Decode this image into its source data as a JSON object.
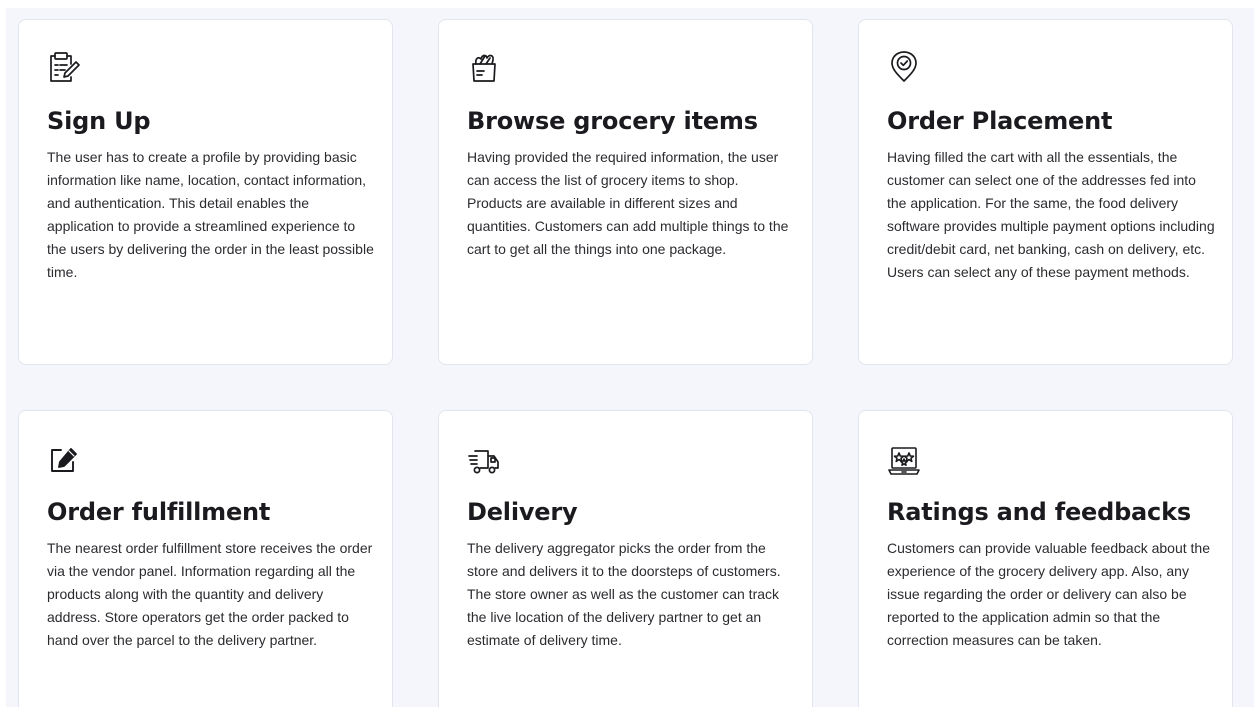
{
  "cards": [
    {
      "icon": "clipboard-edit-icon",
      "title": "Sign Up",
      "description": "The user has to create a profile by providing basic information like name, location, contact information, and authentication. This detail enables the application to provide a streamlined experience to the users by delivering the order in the least possible time."
    },
    {
      "icon": "grocery-bag-icon",
      "title": "Browse grocery items",
      "description": "Having provided the required information, the user can access the list of grocery items to shop. Products are available in different sizes and quantities. Customers can add multiple things to the cart to get all the things into one package."
    },
    {
      "icon": "location-pin-check-icon",
      "title": "Order Placement",
      "description": "Having filled the cart with all the essentials, the customer can select one of the addresses fed into the application. For the same, the food delivery software provides multiple payment options including credit/debit card, net banking, cash on delivery, etc. Users can select any of these payment methods."
    },
    {
      "icon": "edit-pencil-icon",
      "title": "Order fulfillment",
      "description": "The nearest order fulfillment store receives the order via the vendor panel. Information regarding all the products along with the quantity and delivery address. Store operators get the order packed to hand over the parcel to the delivery partner."
    },
    {
      "icon": "delivery-truck-icon",
      "title": "Delivery",
      "description": "The delivery aggregator picks the order from the store and delivers it to the doorsteps of customers. The store owner as well as the customer can track the live location of the delivery partner to get an estimate of delivery time."
    },
    {
      "icon": "laptop-stars-icon",
      "title": "Ratings and feedbacks",
      "description": "Customers can provide valuable feedback about the experience of the grocery delivery app. Also, any issue regarding the order or delivery can also be reported to the application admin so that the correction measures can be taken."
    }
  ]
}
